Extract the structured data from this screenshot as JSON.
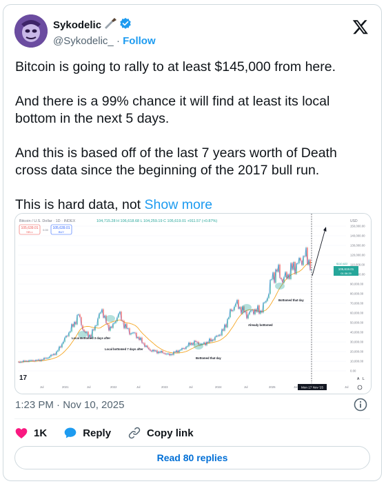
{
  "author": {
    "name": "Sykodelic",
    "handle": "@Sykodelic_",
    "separator": "·",
    "follow_label": "Follow",
    "name_emoji": "knife-icon",
    "verified_color": "#1d9bf0"
  },
  "tweet": {
    "text": "Bitcoin is going to rally to at least $145,000 from here.\n\nAnd there is a 99% chance it will find at least its local bottom in the next 5 days.\n\nAnd this is based off of the last 7 years worth of Death cross data since the beginning of the 2017 bull run.\n\nThis is hard data, not ",
    "show_more_label": "Show more"
  },
  "chart_image": {
    "symbol_line": "Bitcoin / U.S. Dollar · 1D · INDEX",
    "ohlc": "104,715.28  H 106,618.68  L 104,259.19  C 105,619.01  +911.57 (+0.87%)",
    "sell_price": "105,639.01",
    "sell_label": "SELL",
    "spread": "0.00",
    "buy_price": "105,639.01",
    "buy_label": "BUY",
    "currency": "USD",
    "y_ticks": [
      "150,000.00",
      "140,000.00",
      "130,000.00",
      "120,000.00",
      "110,000.00",
      "100,000.00",
      "90,000.00",
      "80,000.00",
      "70,000.00",
      "60,000.00",
      "50,000.00",
      "40,000.00",
      "30,000.00",
      "20,000.00",
      "10,000.00",
      "0.00"
    ],
    "x_ticks": [
      "Jul",
      "2021",
      "Jul",
      "2022",
      "Jul",
      "2023",
      "Jul",
      "2024",
      "Jul",
      "2025",
      "Jul",
      "Jul"
    ],
    "price_tag": "105,619.01",
    "price_tag_sub": "01:36:29",
    "current_price_label": "$110,622",
    "date_tag": "Mon 17 Nov '25",
    "watermark": "17",
    "scale_labels": [
      "A",
      "L"
    ],
    "annotations": [
      {
        "text": "Local Bottomed 3 days after"
      },
      {
        "text": "Local bottomed 7 days after"
      },
      {
        "text": "Bottomed that day"
      },
      {
        "text": "Already bottomed"
      },
      {
        "text": "Bottomed that day"
      }
    ]
  },
  "meta": {
    "timestamp": "1:23 PM · Nov 10, 2025"
  },
  "actions": {
    "likes": "1K",
    "reply_label": "Reply",
    "copy_label": "Copy link",
    "read_replies": "Read 80 replies"
  },
  "colors": {
    "accent": "#1d9bf0",
    "like": "#f91880",
    "price_line": "#2962ff",
    "ma_line": "#f5a623",
    "candle_up": "#26a69a",
    "candle_down": "#ef5350"
  }
}
